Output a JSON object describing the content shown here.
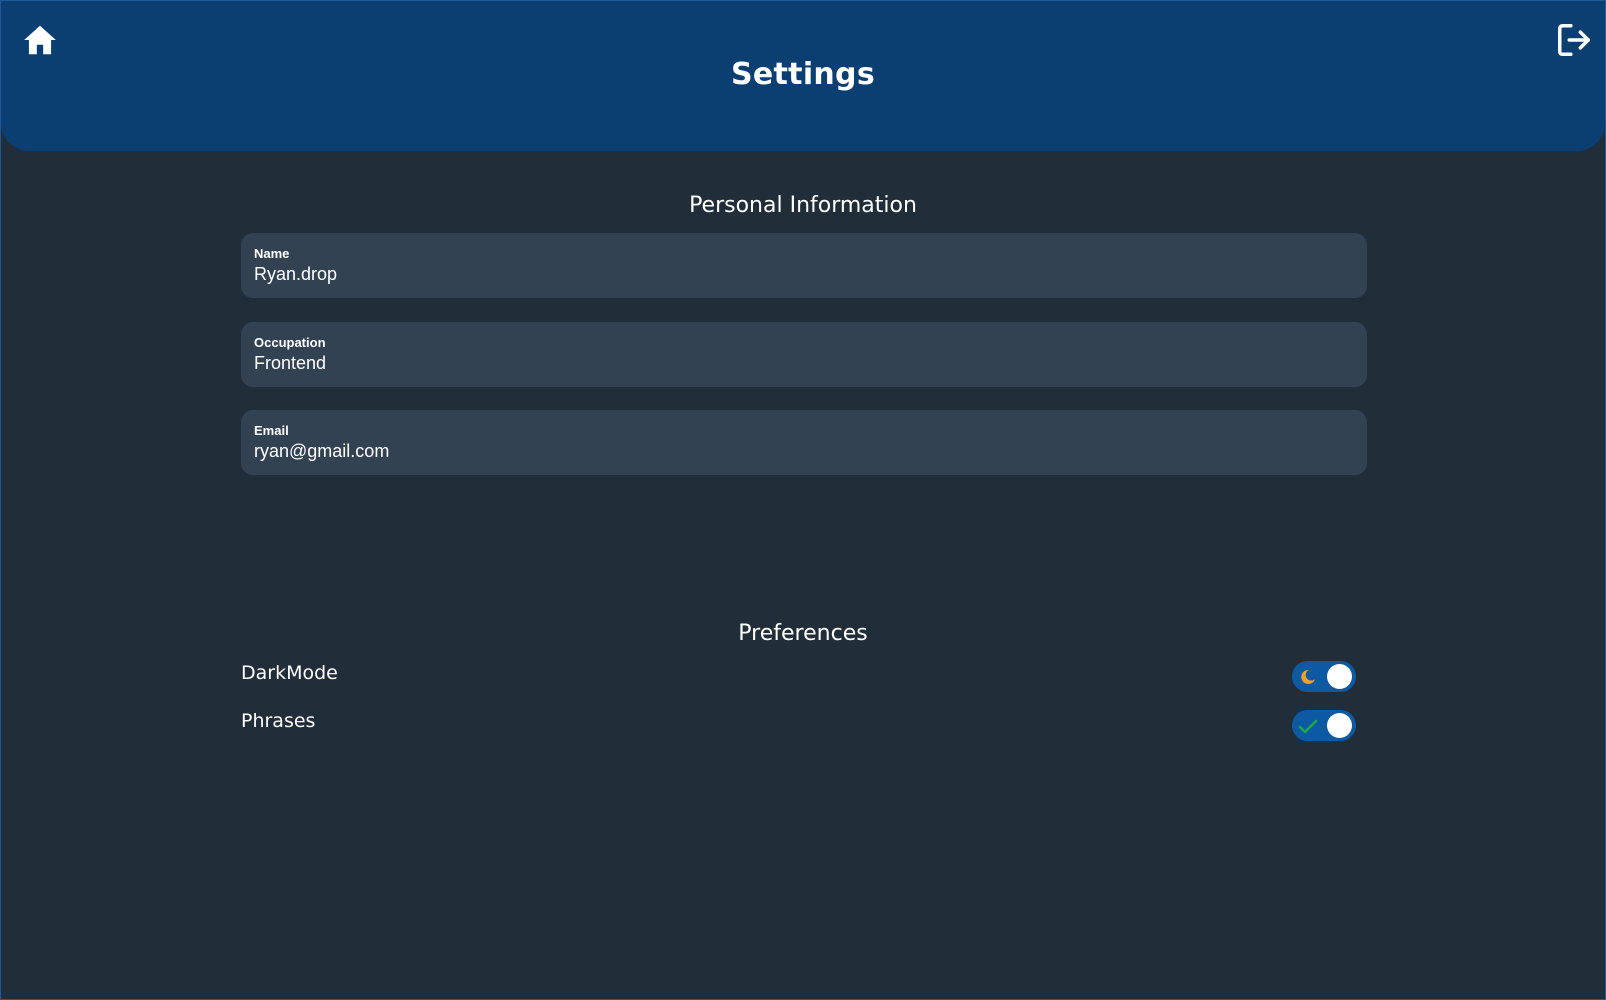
{
  "header": {
    "title": "Settings",
    "home_icon": "home-icon",
    "logout_icon": "logout-icon",
    "background_color": "#0b3f72"
  },
  "personal_information": {
    "title": "Personal Information",
    "fields": [
      {
        "label": "Name",
        "value": "Ryan.drop"
      },
      {
        "label": "Occupation",
        "value": "Frontend"
      },
      {
        "label": "Email",
        "value": "ryan@gmail.com"
      }
    ]
  },
  "preferences": {
    "title": "Preferences",
    "items": [
      {
        "label": "DarkMode",
        "enabled": true,
        "icon": "moon-icon",
        "icon_color": "#f0a030"
      },
      {
        "label": "Phrases",
        "enabled": true,
        "icon": "check-icon",
        "icon_color": "#1aa84a"
      }
    ]
  },
  "colors": {
    "page_background": "#212d38",
    "field_background": "#324253",
    "toggle_track": "#0d5aa3"
  }
}
